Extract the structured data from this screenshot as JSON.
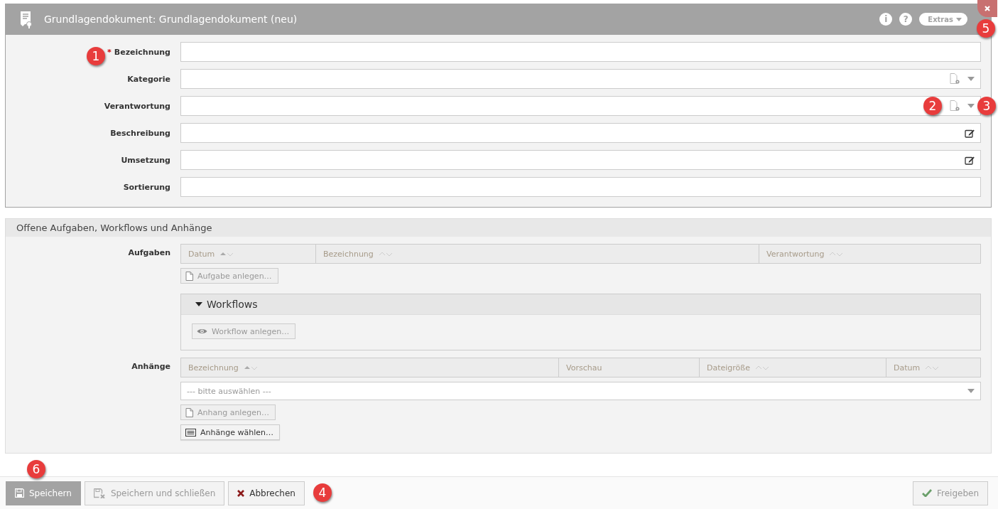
{
  "window": {
    "title": "Grundlagendokument: Grundlagendokument (neu)",
    "header_buttons": [
      {
        "label": "i"
      },
      {
        "label": "?"
      }
    ],
    "extras": "Extras",
    "close_callout": "5"
  },
  "fields": [
    {
      "label": "Bezeichnung",
      "required_mark": "*",
      "kind": "text",
      "callout": "1"
    },
    {
      "label": "Kategorie",
      "kind": "lookup"
    },
    {
      "label": "Verantwortung",
      "kind": "lookup",
      "icon_callout": "2",
      "caret_callout": "3"
    },
    {
      "label": "Beschreibung",
      "kind": "editor"
    },
    {
      "label": "Umsetzung",
      "kind": "editor"
    },
    {
      "label": "Sortierung",
      "kind": "text"
    }
  ],
  "section": {
    "title": "Offene Aufgaben, Workflows und Anhänge",
    "aufgaben": {
      "label": "Aufgaben",
      "columns": [
        {
          "title": "Datum",
          "sortable": true,
          "sorted": true
        },
        {
          "title": "Bezeichnung",
          "sortable": true,
          "sorted": false
        },
        {
          "title": "Verantwortung",
          "sortable": true,
          "sorted": false
        }
      ],
      "button": {
        "label": "Aufgabe anlegen…",
        "disabled": true
      }
    },
    "workflows": {
      "title": "Workflows",
      "expanded": true,
      "button": {
        "label": "Workflow anlegen…",
        "disabled": true
      }
    },
    "anhaenge": {
      "label": "Anhänge",
      "columns": [
        {
          "title": "Bezeichnung",
          "sortable": true,
          "sorted": true
        },
        {
          "title": "Vorschau",
          "sortable": false
        },
        {
          "title": "Dateigröße",
          "sortable": true,
          "sorted": false
        },
        {
          "title": "Datum",
          "sortable": true,
          "sorted": false
        }
      ],
      "select_placeholder": "--- bitte auswählen ---",
      "buttons": [
        {
          "label": "Anhang anlegen…",
          "kind": "new",
          "disabled": true
        },
        {
          "label": "Anhänge wählen…",
          "kind": "choose",
          "disabled": false
        }
      ]
    }
  },
  "footer": {
    "buttons": [
      {
        "label": "Speichern",
        "kind": "save",
        "primary": true,
        "disabled": false,
        "callout": "6"
      },
      {
        "label": "Speichern und schließen",
        "kind": "save-close",
        "primary": false,
        "disabled": true
      },
      {
        "label": "Abbrechen",
        "kind": "cancel",
        "primary": false,
        "disabled": false,
        "callout": "4"
      }
    ],
    "right_button": {
      "label": "Freigeben",
      "kind": "approve",
      "primary": false,
      "disabled": true
    }
  }
}
